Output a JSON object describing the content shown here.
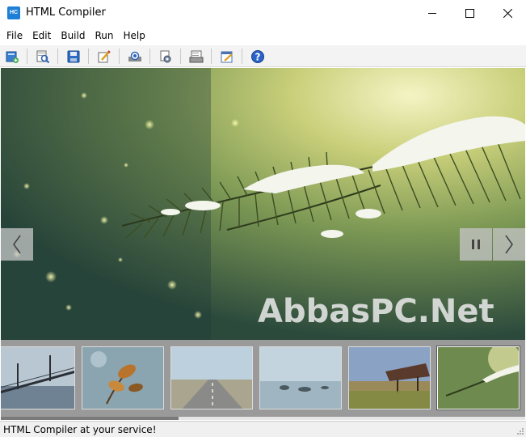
{
  "window": {
    "title": "HTML Compiler",
    "app_icon_text": "HC"
  },
  "menu": [
    "File",
    "Edit",
    "Build",
    "Run",
    "Help"
  ],
  "toolbar": [
    {
      "name": "new-project-icon"
    },
    {
      "name": "open-project-icon"
    },
    {
      "name": "save-icon"
    },
    {
      "name": "edit-icon"
    },
    {
      "name": "preview-icon"
    },
    {
      "name": "settings-icon"
    },
    {
      "name": "compile-icon"
    },
    {
      "name": "edit-page-icon"
    },
    {
      "name": "help-icon"
    }
  ],
  "viewer": {
    "watermark": "AbbasPC.Net",
    "prev_icon": "chevron-left-icon",
    "pause_icon": "pause-icon",
    "next_icon": "chevron-right-icon",
    "thumbnails": [
      {
        "name": "thumb-bridge",
        "active": false
      },
      {
        "name": "thumb-leaves",
        "active": false
      },
      {
        "name": "thumb-road",
        "active": false
      },
      {
        "name": "thumb-lake",
        "active": false
      },
      {
        "name": "thumb-pier",
        "active": false
      },
      {
        "name": "thumb-pine",
        "active": true
      }
    ]
  },
  "status": {
    "text": "HTML Compiler at your service!"
  },
  "colors": {
    "accent": "#1e7fd8",
    "statusbar": "#f0f0f0",
    "thumbstrip": "#9a9a9a"
  }
}
